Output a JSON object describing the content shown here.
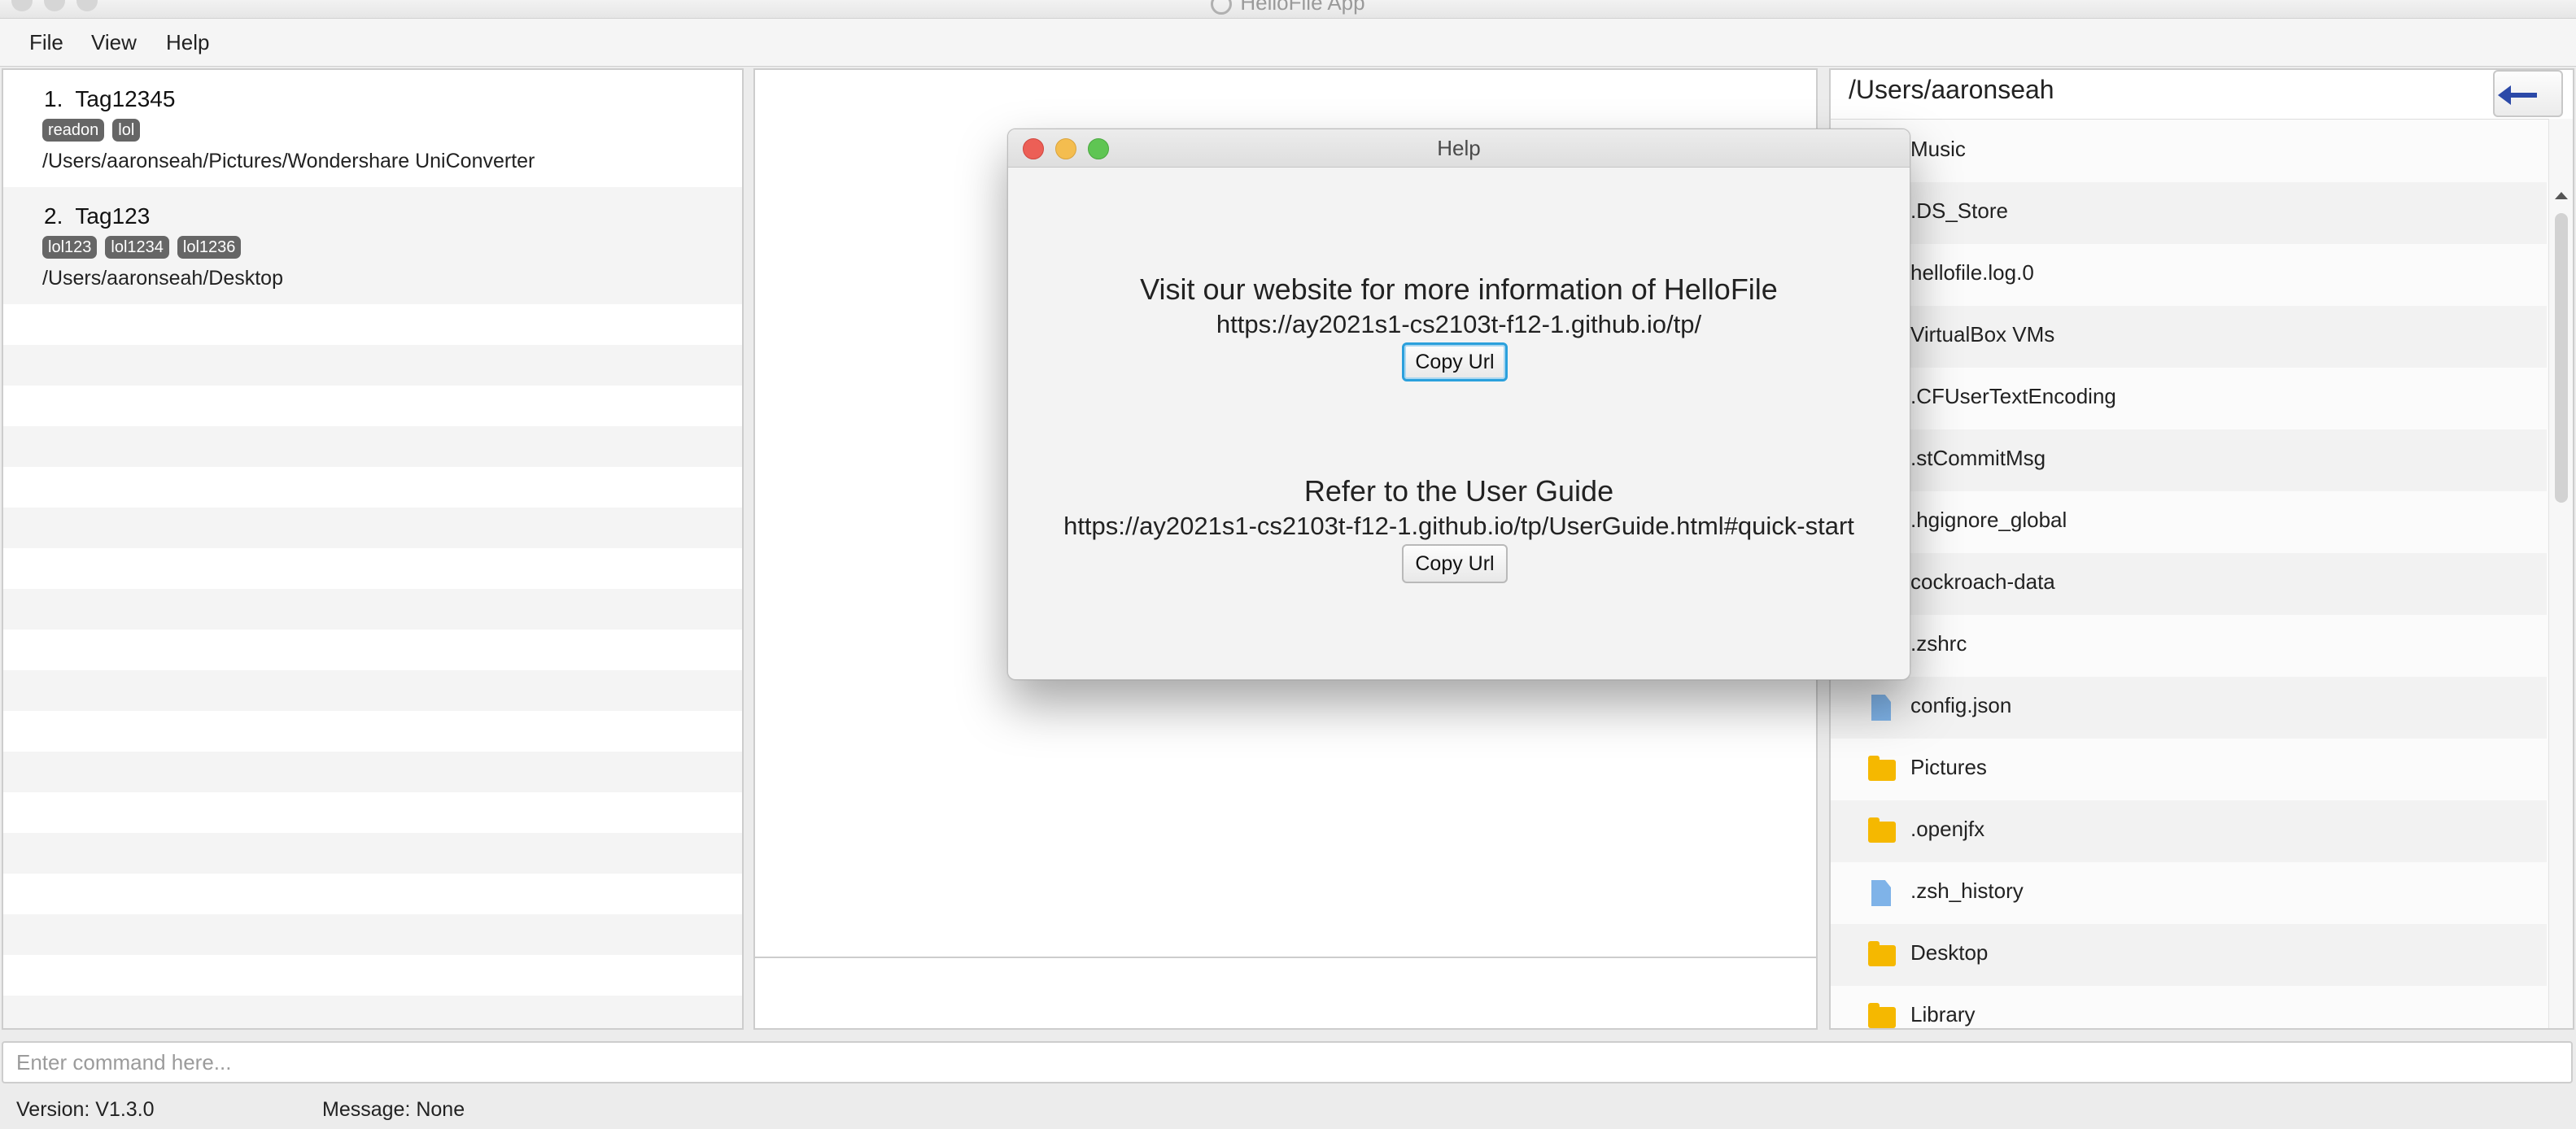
{
  "window": {
    "title": "HelloFile App"
  },
  "menu": [
    {
      "label": "File"
    },
    {
      "label": "View"
    },
    {
      "label": "Help"
    }
  ],
  "tag_list": [
    {
      "index": "1.",
      "name": "Tag12345",
      "tags": [
        "readon",
        "lol"
      ],
      "path": "/Users/aaronseah/Pictures/Wondershare UniConverter"
    },
    {
      "index": "2.",
      "name": "Tag123",
      "tags": [
        "lol123",
        "lol1234",
        "lol1236"
      ],
      "path": "/Users/aaronseah/Desktop"
    }
  ],
  "file_browser": {
    "current_path": "/Users/aaronseah",
    "back_button": "back-arrow-icon",
    "files": [
      {
        "name": "Music",
        "type": "folder"
      },
      {
        "name": ".DS_Store",
        "type": "file"
      },
      {
        "name": "hellofile.log.0",
        "type": "file"
      },
      {
        "name": "VirtualBox VMs",
        "type": "folder"
      },
      {
        "name": ".CFUserTextEncoding",
        "type": "file"
      },
      {
        "name": ".stCommitMsg",
        "type": "file"
      },
      {
        "name": ".hgignore_global",
        "type": "file"
      },
      {
        "name": "cockroach-data",
        "type": "folder"
      },
      {
        "name": ".zshrc",
        "type": "file"
      },
      {
        "name": "config.json",
        "type": "file"
      },
      {
        "name": "Pictures",
        "type": "folder"
      },
      {
        "name": ".openjfx",
        "type": "folder"
      },
      {
        "name": ".zsh_history",
        "type": "file"
      },
      {
        "name": "Desktop",
        "type": "folder"
      },
      {
        "name": "Library",
        "type": "folder"
      }
    ]
  },
  "command": {
    "placeholder": "Enter command here..."
  },
  "status": {
    "version": "Version: V1.3.0",
    "message": "Message: None"
  },
  "help_dialog": {
    "title": "Help",
    "website_heading": "Visit our website for more information of HelloFile",
    "website_url": "https://ay2021s1-cs2103t-f12-1.github.io/tp/",
    "guide_heading": "Refer to the User Guide",
    "guide_url": "https://ay2021s1-cs2103t-f12-1.github.io/tp/UserGuide.html#quick-start",
    "copy_label": "Copy Url"
  },
  "colors": {
    "accent": "#2ba0dc",
    "folder": "#f5b800",
    "file": "#7fb3e8",
    "back_arrow": "#2b49a8",
    "tag": "#666666"
  }
}
